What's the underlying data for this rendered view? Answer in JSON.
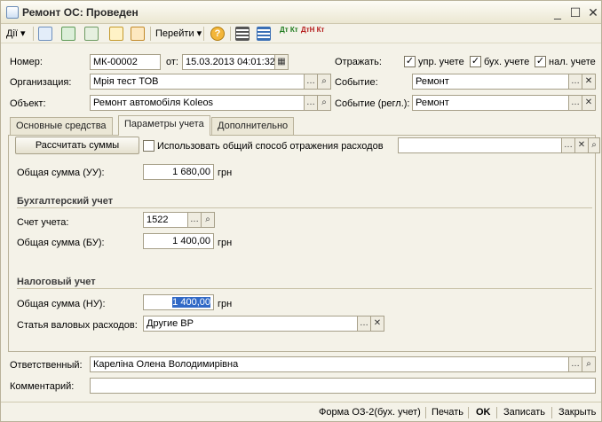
{
  "window": {
    "title": "Ремонт ОС: Проведен"
  },
  "toolbar": {
    "actions_label": "Дії",
    "goto_label": "Перейти",
    "dt_kt_1": "Дт Кт",
    "dt_kt_2": "ДтН Кт"
  },
  "header": {
    "number_label": "Номер:",
    "number_value": "МК-00002",
    "date_label": "от:",
    "date_value": "15.03.2013 04:01:32",
    "reflect_label": "Отражать:",
    "reflect": [
      {
        "label": "упр. учете",
        "checked": true
      },
      {
        "label": "бух. учете",
        "checked": true
      },
      {
        "label": "нал. учете",
        "checked": true
      }
    ],
    "org_label": "Организация:",
    "org_value": "Мрія тест ТОВ",
    "event_label": "Событие:",
    "event_value": "Ремонт",
    "object_label": "Объект:",
    "object_value": "Ремонт автомобіля Koleos",
    "event_reg_label": "Событие (регл.):",
    "event_reg_value": "Ремонт"
  },
  "tabs": [
    {
      "label": "Основные средства",
      "active": false
    },
    {
      "label": "Параметры учета",
      "active": true
    },
    {
      "label": "Дополнительно",
      "active": false
    }
  ],
  "params": {
    "calc_button": "Рассчитать суммы",
    "common_method_label": "Использовать общий способ отражения расходов",
    "common_method_value": "",
    "total_uu_label": "Общая сумма (УУ):",
    "total_uu_value": "1 680,00",
    "currency": "грн",
    "accounting_title": "Бухгалтерский учет",
    "account_label": "Счет учета:",
    "account_value": "1522",
    "total_bu_label": "Общая сумма (БУ):",
    "total_bu_value": "1 400,00",
    "tax_title": "Налоговый учет",
    "total_nu_label": "Общая сумма (НУ):",
    "total_nu_value": "1 400,00",
    "gross_exp_label": "Статья валовых расходов:",
    "gross_exp_value": "Другие ВР"
  },
  "footer": {
    "responsible_label": "Ответственный:",
    "responsible_value": "Кареліна Олена Володимирівна",
    "comment_label": "Комментарий:",
    "comment_value": ""
  },
  "statusbar": {
    "form_label": "Форма ОЗ-2(бух. учет)",
    "print_label": "Печать",
    "ok_label": "OK",
    "save_label": "Записать",
    "close_label": "Закрыть"
  }
}
